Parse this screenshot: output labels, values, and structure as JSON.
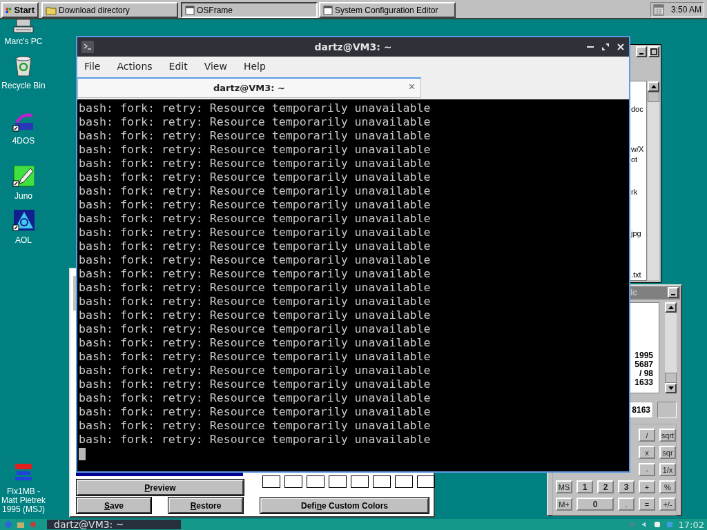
{
  "top_taskbar": {
    "start": "Start",
    "tasks": [
      {
        "label": "Download directory",
        "kind": "folder"
      },
      {
        "label": "OSFrame",
        "kind": "window"
      },
      {
        "label": "System Configuration Editor",
        "kind": "window"
      }
    ],
    "clock": "3:50 AM"
  },
  "desktop_icons": [
    {
      "label": "Marc's PC",
      "kind": "computer"
    },
    {
      "label": "Recycle Bin",
      "kind": "bin"
    },
    {
      "label": "4DOS",
      "kind": "dos"
    },
    {
      "label": "Juno",
      "kind": "pen"
    },
    {
      "label": "AOL",
      "kind": "triangle"
    },
    {
      "label": "Fix1MB - Matt Pietrek 1995 (MSJ)",
      "kind": "note"
    }
  ],
  "file_window": {
    "items": [
      "doc",
      "w/X",
      "ot",
      "rk",
      "jpg",
      ".txt"
    ]
  },
  "calc_window": {
    "title": "lc",
    "display_lines": [
      "1995",
      "5687",
      "/ 98",
      "1633"
    ],
    "entry": "8163",
    "button_rows": [
      [
        null,
        null,
        null,
        null,
        {
          "label": "/"
        },
        {
          "label": "sqrt"
        }
      ],
      [
        null,
        null,
        null,
        null,
        {
          "label": "x"
        },
        {
          "label": "sqr"
        }
      ],
      [
        null,
        null,
        null,
        null,
        {
          "label": "-"
        },
        {
          "label": "1/x"
        }
      ],
      [
        {
          "label": "MS"
        },
        {
          "label": "1",
          "kind": "bold"
        },
        {
          "label": "2",
          "kind": "bold"
        },
        {
          "label": "3",
          "kind": "bold"
        },
        {
          "label": "+"
        },
        {
          "label": "%"
        }
      ],
      [
        {
          "label": "M+"
        },
        {
          "label": "0",
          "kind": "wide"
        },
        {
          "label": "."
        },
        {
          "label": "="
        },
        {
          "label": "+/-"
        }
      ]
    ]
  },
  "color_dialog": {
    "buttons": [
      {
        "label_parts": [
          {
            "text": "P",
            "underlined": true
          },
          {
            "text": "review",
            "underlined": false
          }
        ],
        "kind": "wide"
      },
      {
        "label_parts": [
          {
            "text": "S",
            "underlined": true
          },
          {
            "text": "ave",
            "underlined": false
          }
        ],
        "kind": "half"
      },
      {
        "label_parts": [
          {
            "text": "R",
            "underlined": true
          },
          {
            "text": "estore",
            "underlined": false
          }
        ],
        "kind": "half"
      },
      {
        "label_parts": [
          {
            "text": "Defi",
            "underlined": false
          },
          {
            "text": "n",
            "underlined": true
          },
          {
            "text": "e Custom Colors",
            "underlined": false
          }
        ],
        "kind": "define"
      }
    ]
  },
  "terminal": {
    "title": "dartz@VM3: ~",
    "menu": [
      "File",
      "Actions",
      "Edit",
      "View",
      "Help"
    ],
    "tab": {
      "label": "dartz@VM3: ~",
      "close": "×",
      "selected": true
    },
    "lines": [
      "bash: fork: retry: Resource temporarily unavailable",
      "bash: fork: retry: Resource temporarily unavailable",
      "bash: fork: retry: Resource temporarily unavailable",
      "bash: fork: retry: Resource temporarily unavailable",
      "bash: fork: retry: Resource temporarily unavailable",
      "bash: fork: retry: Resource temporarily unavailable",
      "bash: fork: retry: Resource temporarily unavailable",
      "bash: fork: retry: Resource temporarily unavailable",
      "bash: fork: retry: Resource temporarily unavailable",
      "bash: fork: retry: Resource temporarily unavailable",
      "bash: fork: retry: Resource temporarily unavailable",
      "bash: fork: retry: Resource temporarily unavailable",
      "bash: fork: retry: Resource temporarily unavailable",
      "bash: fork: retry: Resource temporarily unavailable",
      "bash: fork: retry: Resource temporarily unavailable",
      "bash: fork: retry: Resource temporarily unavailable",
      "bash: fork: retry: Resource temporarily unavailable",
      "bash: fork: retry: Resource temporarily unavailable",
      "bash: fork: retry: Resource temporarily unavailable",
      "bash: fork: retry: Resource temporarily unavailable",
      "bash: fork: retry: Resource temporarily unavailable",
      "bash: fork: retry: Resource temporarily unavailable",
      "bash: fork: retry: Resource temporarily unavailable",
      "bash: fork: retry: Resource temporarily unavailable",
      "bash: fork: retry: Resource temporarily unavailable"
    ]
  },
  "bottom_taskbar": {
    "task": "dartz@VM3: ~",
    "clock": "17:02"
  }
}
